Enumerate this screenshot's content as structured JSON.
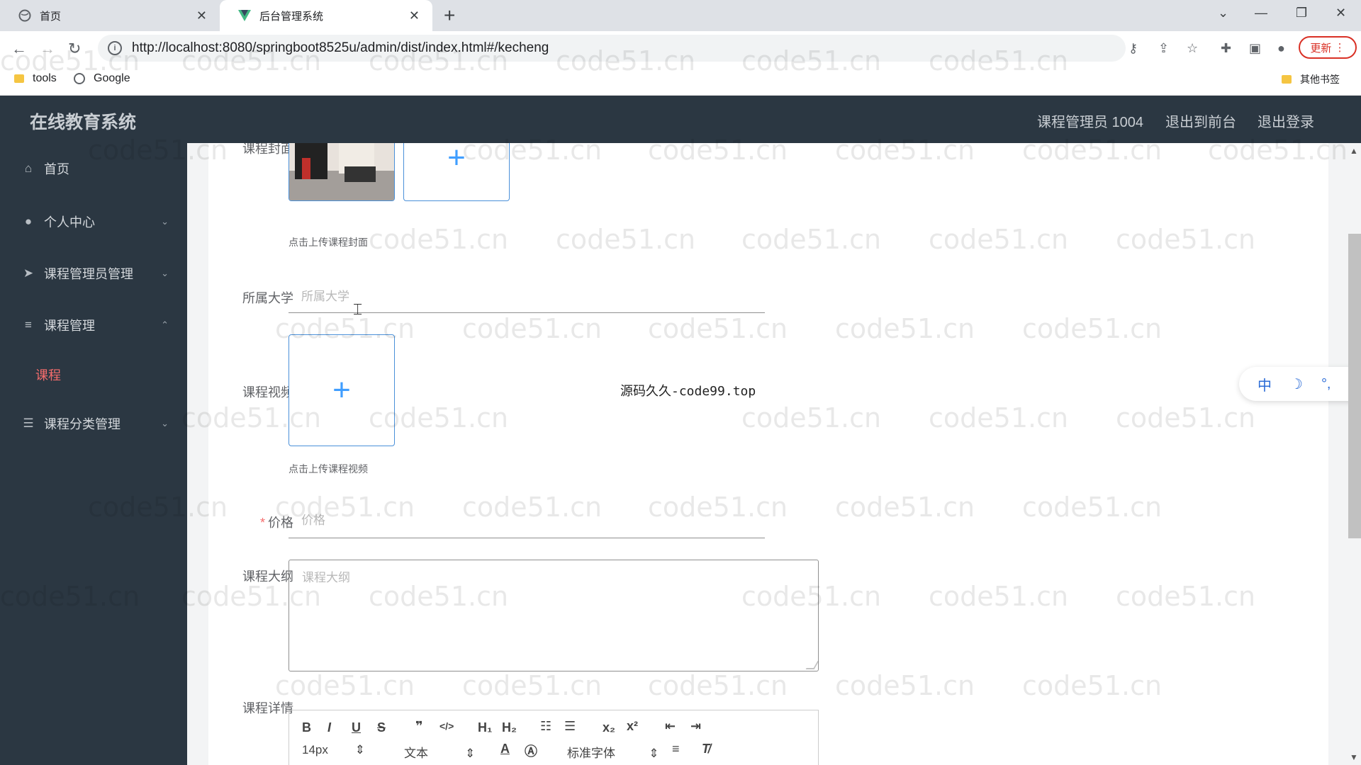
{
  "browser": {
    "tabs": [
      {
        "title": "首页",
        "active": false
      },
      {
        "title": "后台管理系统",
        "active": true
      }
    ],
    "url": "http://localhost:8080/springboot8525u/admin/dist/index.html#/kecheng",
    "update_label": "更新",
    "bookmarks": [
      {
        "label": "tools",
        "icon": "folder-icon"
      },
      {
        "label": "Google",
        "icon": "globe-icon"
      }
    ],
    "other_bookmarks": "其他书签"
  },
  "header": {
    "title": "在线教育系统",
    "user": "课程管理员 1004",
    "back_to_front": "退出到前台",
    "logout": "退出登录"
  },
  "sidebar": {
    "items": [
      {
        "label": "首页",
        "icon": "home-icon"
      },
      {
        "label": "个人中心",
        "icon": "user-icon"
      },
      {
        "label": "课程管理员管理",
        "icon": "send-icon"
      },
      {
        "label": "课程管理",
        "icon": "sliders-icon"
      },
      {
        "label": "课程分类管理",
        "icon": "list-icon"
      }
    ],
    "active_sub": "课程",
    "active_color": "#f56c6c"
  },
  "form": {
    "cover_label": "课程封面",
    "cover_tip": "点击上传课程封面",
    "university_label": "所属大学",
    "university_placeholder": "所属大学",
    "video_label": "课程视频",
    "video_tip": "点击上传课程视频",
    "price_label": "价格",
    "price_required_mark": "*",
    "price_placeholder": "价格",
    "outline_label": "课程大纲",
    "outline_placeholder": "课程大纲",
    "detail_label": "课程详情"
  },
  "editor": {
    "font_size": "14px",
    "block_type": "文本",
    "font_family": "标准字体"
  },
  "overlay": {
    "center_text": "源码久久-code99.top",
    "watermark": "code51.cn",
    "widget_items": [
      "中",
      "☽",
      "°,",
      "›"
    ]
  }
}
